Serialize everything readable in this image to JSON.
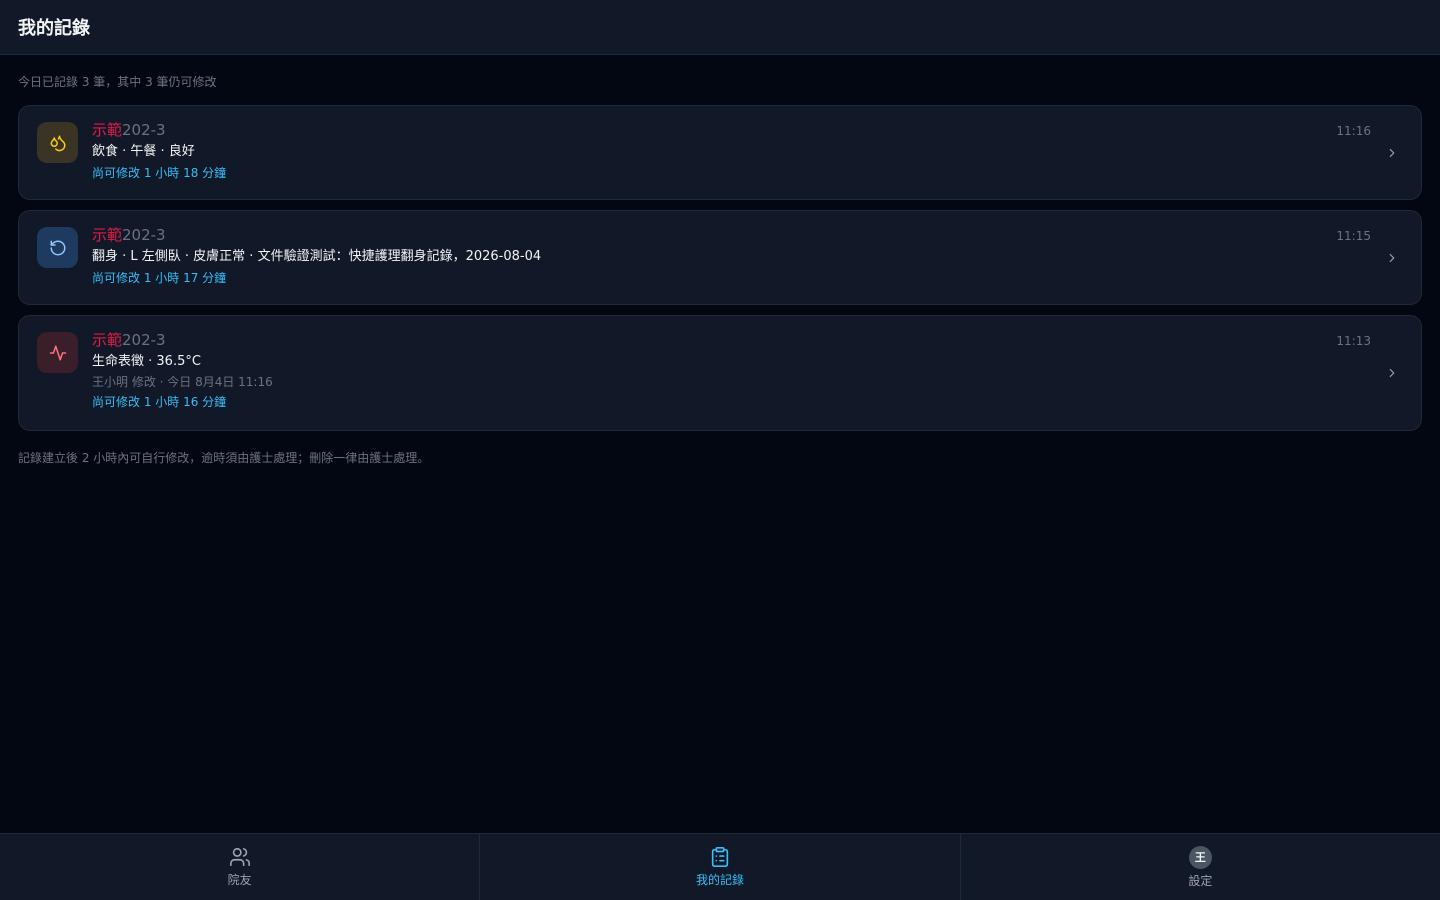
{
  "header": {
    "title": "我的記錄"
  },
  "summary": "今日已記錄 3 筆，其中 3 筆仍可修改",
  "records": [
    {
      "icon": "droplets-icon",
      "icon_color": "#facc15",
      "icon_bg": "#3a3424",
      "name_prefix": "示範",
      "name_suffix": "202-3",
      "detail": "飲食 · 午餐 · 良好",
      "time": "11:16",
      "remaining": "尚可修改 1 小時 18 分鐘"
    },
    {
      "icon": "rotate-ccw-icon",
      "icon_color": "#93c5fd",
      "icon_bg": "#1e3a5f",
      "name_prefix": "示範",
      "name_suffix": "202-3",
      "detail": "翻身 · L 左側臥 · 皮膚正常 · 文件驗證測試：快捷護理翻身記錄，2026-08-04",
      "time": "11:15",
      "remaining": "尚可修改 1 小時 17 分鐘"
    },
    {
      "icon": "activity-icon",
      "icon_color": "#fb7185",
      "icon_bg": "#3a1f2b",
      "name_prefix": "示範",
      "name_suffix": "202-3",
      "detail": "生命表徵 · 36.5°C",
      "editor": "王小明 修改 · 今日 8月4日 11:16",
      "time": "11:13",
      "remaining": "尚可修改 1 小時 16 分鐘"
    }
  ],
  "footnote": "記錄建立後 2 小時內可自行修改，逾時須由護士處理；刪除一律由護士處理。",
  "tabs": [
    {
      "label": "院友",
      "icon": "users-icon",
      "active": false
    },
    {
      "label": "我的記錄",
      "icon": "clipboard-list-icon",
      "active": true
    },
    {
      "label": "設定",
      "icon": "avatar",
      "avatar_text": "王",
      "active": false
    }
  ],
  "colors": {
    "background": "#030712",
    "surface": "#111827",
    "accent": "#38bdf8",
    "name_highlight": "#e11d48"
  }
}
